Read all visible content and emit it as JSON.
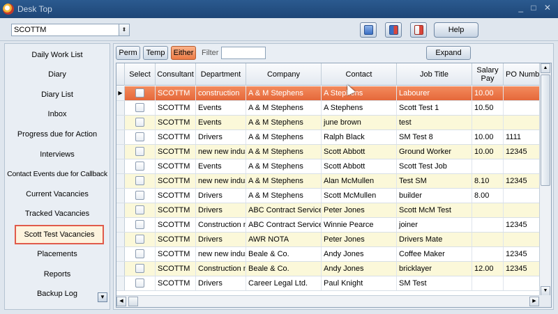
{
  "window": {
    "title": "Desk Top",
    "controls": "_ □ ✕"
  },
  "topbar": {
    "user_combo_value": "SCOTTM",
    "help_label": "Help"
  },
  "sidebar": {
    "items": [
      {
        "label": "Daily Work List"
      },
      {
        "label": "Diary"
      },
      {
        "label": "Diary List"
      },
      {
        "label": "Inbox"
      },
      {
        "label": "Progress due for Action"
      },
      {
        "label": "Interviews"
      },
      {
        "label": "Contact Events due for Callback"
      },
      {
        "label": "Current Vacancies"
      },
      {
        "label": "Tracked Vacancies"
      },
      {
        "label": "Scott Test Vacancies"
      },
      {
        "label": "Placements"
      },
      {
        "label": "Reports"
      },
      {
        "label": "Backup Log"
      }
    ],
    "active_index": 9
  },
  "toolbar": {
    "perm_label": "Perm",
    "temp_label": "Temp",
    "either_label": "Either",
    "filter_label": "Filter",
    "filter_value": "",
    "expand_label": "Expand"
  },
  "grid": {
    "columns": [
      "Select",
      "Consultant",
      "Department",
      "Company",
      "Contact",
      "Job Title",
      "Salary Pay",
      "PO Numbe"
    ],
    "rows": [
      [
        "",
        "SCOTTM",
        "construction",
        "A & M Stephens",
        "A Stephens",
        "Labourer",
        "10.00",
        ""
      ],
      [
        "",
        "SCOTTM",
        "Events",
        "A & M Stephens",
        "A Stephens",
        "Scott Test 1",
        "10.50",
        ""
      ],
      [
        "",
        "SCOTTM",
        "Events",
        "A & M Stephens",
        "june brown",
        "test",
        "",
        ""
      ],
      [
        "",
        "SCOTTM",
        "Drivers",
        "A & M Stephens",
        "Ralph Black",
        "SM Test 8",
        "10.00",
        "1111"
      ],
      [
        "",
        "SCOTTM",
        "new new indus",
        "A & M Stephens",
        "Scott Abbott",
        "Ground Worker",
        "10.00",
        "12345"
      ],
      [
        "",
        "SCOTTM",
        "Events",
        "A & M Stephens",
        "Scott Abbott",
        "Scott Test Job",
        "",
        ""
      ],
      [
        "",
        "SCOTTM",
        "new new indus",
        "A & M Stephens",
        "Alan McMullen",
        "Test SM",
        "8.10",
        "12345"
      ],
      [
        "",
        "SCOTTM",
        "Drivers",
        "A & M Stephens",
        "Scott McMullen",
        "builder",
        "8.00",
        ""
      ],
      [
        "",
        "SCOTTM",
        "Drivers",
        "ABC Contract Services",
        "Peter Jones",
        "Scott McM Test",
        "",
        ""
      ],
      [
        "",
        "SCOTTM",
        "Construction ne",
        "ABC Contract Services",
        "Winnie Pearce",
        "joiner",
        "",
        "12345"
      ],
      [
        "",
        "SCOTTM",
        "Drivers",
        "AWR  NOTA",
        "Peter Jones",
        "Drivers Mate",
        "",
        ""
      ],
      [
        "",
        "SCOTTM",
        "new new indus",
        "Beale & Co.",
        "Andy Jones",
        "Coffee Maker",
        "",
        "12345"
      ],
      [
        "",
        "SCOTTM",
        "Construction ne",
        "Beale & Co.",
        "Andy Jones",
        "bricklayer",
        "12.00",
        "12345"
      ],
      [
        "",
        "SCOTTM",
        "Drivers",
        "Career Legal Ltd.",
        "Paul Knight",
        "SM Test",
        "",
        ""
      ]
    ]
  },
  "colors": {
    "selected_row": "#e5683a",
    "alt_row": "#fbf8d9",
    "active_toggle": "#ec7a45",
    "active_sidebar_border": "#e05a4a"
  }
}
